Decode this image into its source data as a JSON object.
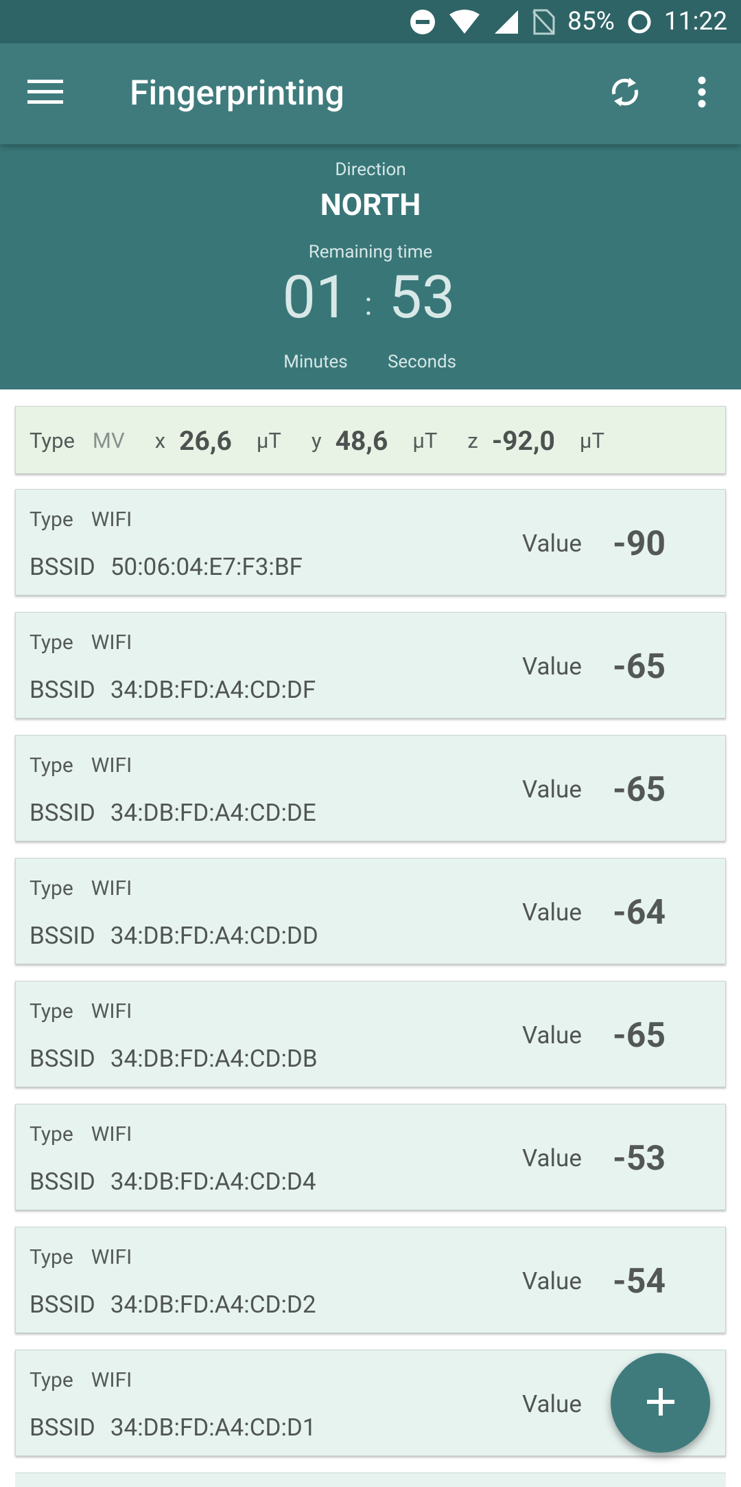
{
  "status_bar": {
    "battery_percent": "85%",
    "time": "11:22"
  },
  "app_bar": {
    "title": "Fingerprinting",
    "icons": [
      "menu-icon",
      "sync-icon",
      "more-vert-icon"
    ]
  },
  "header": {
    "direction_label": "Direction",
    "direction_value": "NORTH",
    "remaining_label": "Remaining time",
    "minutes": "01",
    "separator": ":",
    "seconds": "53",
    "minutes_label": "Minutes",
    "seconds_label": "Seconds"
  },
  "magnetic": {
    "type_label": "Type",
    "type_value": "MV",
    "x_label": "x",
    "x_value": "26,6",
    "y_label": "y",
    "y_value": "48,6",
    "z_label": "z",
    "z_value": "-92,0",
    "unit": "µT"
  },
  "wifi_list": {
    "type_label": "Type",
    "bssid_label": "BSSID",
    "value_label": "Value",
    "items": [
      {
        "type": "WIFI",
        "bssid": "50:06:04:E7:F3:BF",
        "value": "-90"
      },
      {
        "type": "WIFI",
        "bssid": "34:DB:FD:A4:CD:DF",
        "value": "-65"
      },
      {
        "type": "WIFI",
        "bssid": "34:DB:FD:A4:CD:DE",
        "value": "-65"
      },
      {
        "type": "WIFI",
        "bssid": "34:DB:FD:A4:CD:DD",
        "value": "-64"
      },
      {
        "type": "WIFI",
        "bssid": "34:DB:FD:A4:CD:DB",
        "value": "-65"
      },
      {
        "type": "WIFI",
        "bssid": "34:DB:FD:A4:CD:D4",
        "value": "-53"
      },
      {
        "type": "WIFI",
        "bssid": "34:DB:FD:A4:CD:D2",
        "value": "-54"
      },
      {
        "type": "WIFI",
        "bssid": "34:DB:FD:A4:CD:D1",
        "value": ""
      }
    ]
  },
  "fab": {
    "icon": "add-icon"
  },
  "colors": {
    "status_bar": "#2f6466",
    "app_bar": "#3f7b7d",
    "header": "#397678",
    "card_mv": "#e8f3e6",
    "card_wifi": "#e7f3ef"
  }
}
